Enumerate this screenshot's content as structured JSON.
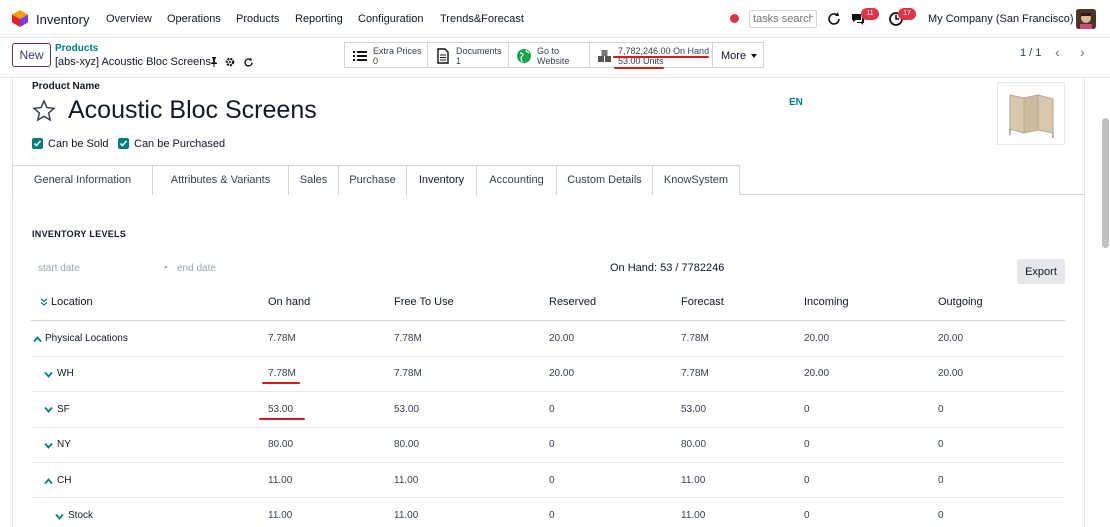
{
  "nav": {
    "app_name": "Inventory",
    "menu": [
      "Overview",
      "Operations",
      "Products",
      "Reporting",
      "Configuration",
      "Trends&Forecast"
    ],
    "search_placeholder": "tasks search",
    "chat_badge": "11",
    "activity_badge": "17",
    "company": "My Company (San Francisco)"
  },
  "control": {
    "new_label": "New",
    "breadcrumb_parent": "Products",
    "breadcrumb_current": "[abs-xyz] Acoustic Bloc Screens",
    "smart_buttons": [
      {
        "icon": "list-icon",
        "line1": "Extra Prices",
        "line2": "0"
      },
      {
        "icon": "document-icon",
        "line1": "Documents",
        "line2": "1"
      },
      {
        "icon": "globe-icon",
        "line1": "Go to",
        "line2": "Website"
      },
      {
        "icon": "boxes-icon",
        "line1": "7,782,246.00 On Hand",
        "line2": "53.00 Units"
      }
    ],
    "more_label": "More",
    "pager": "1 / 1"
  },
  "form": {
    "name_label": "Product Name",
    "product_name": "Acoustic Bloc Screens",
    "lang": "EN",
    "can_be_sold": "Can be Sold",
    "can_be_purchased": "Can be Purchased"
  },
  "tabs": [
    "General Information",
    "Attributes & Variants",
    "Sales",
    "Purchase",
    "Inventory",
    "Accounting",
    "Custom Details",
    "KnowSystem"
  ],
  "active_tab": "Inventory",
  "inventory": {
    "section_title": "INVENTORY LEVELS",
    "start_date_placeholder": "start date",
    "dash": "-",
    "end_date_placeholder": "end date",
    "on_hand_summary": "On Hand: 53 / 7782246",
    "export_label": "Export",
    "columns": [
      "Location",
      "On hand",
      "Free To Use",
      "Reserved",
      "Forecast",
      "Incoming",
      "Outgoing"
    ],
    "rows": [
      {
        "location": "Physical Locations",
        "caret": "up",
        "on_hand": "7.78M",
        "free": "7.78M",
        "reserved": "20.00",
        "forecast": "7.78M",
        "incoming": "20.00",
        "outgoing": "20.00"
      },
      {
        "location": "WH",
        "caret": "down",
        "on_hand": "7.78M",
        "free": "7.78M",
        "reserved": "20.00",
        "forecast": "7.78M",
        "incoming": "20.00",
        "outgoing": "20.00"
      },
      {
        "location": "SF",
        "caret": "down",
        "on_hand": "53.00",
        "free": "53.00",
        "reserved": "0",
        "forecast": "53.00",
        "incoming": "0",
        "outgoing": "0"
      },
      {
        "location": "NY",
        "caret": "down",
        "on_hand": "80.00",
        "free": "80.00",
        "reserved": "0",
        "forecast": "80.00",
        "incoming": "0",
        "outgoing": "0"
      },
      {
        "location": "CH",
        "caret": "up",
        "on_hand": "11.00",
        "free": "11.00",
        "reserved": "0",
        "forecast": "11.00",
        "incoming": "0",
        "outgoing": "0"
      },
      {
        "location": "Stock",
        "caret": "down",
        "on_hand": "11.00",
        "free": "11.00",
        "reserved": "0",
        "forecast": "11.00",
        "incoming": "0",
        "outgoing": "0"
      }
    ]
  },
  "colors": {
    "accent": "#017e84",
    "brand": "#714b67",
    "annotation": "#d91a1a",
    "badge": "#dc3545"
  }
}
